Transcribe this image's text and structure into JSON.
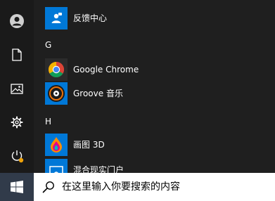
{
  "rail": {
    "items": [
      {
        "name": "user-account",
        "icon": "user-avatar-icon"
      },
      {
        "name": "documents",
        "icon": "document-icon"
      },
      {
        "name": "pictures",
        "icon": "picture-icon"
      },
      {
        "name": "settings",
        "icon": "gear-icon"
      },
      {
        "name": "power",
        "icon": "power-icon"
      }
    ],
    "power_badge_color": "#f0a30a"
  },
  "app_list": {
    "groups": [
      {
        "letter": "G"
      },
      {
        "letter": "H"
      }
    ],
    "apps": [
      {
        "label": "反馈中心",
        "icon": "feedback-hub-icon",
        "tile_color": "#0078d7"
      },
      {
        "label": "Google Chrome",
        "icon": "chrome-icon",
        "tile_color": "#2b2b2b"
      },
      {
        "label": "Groove 音乐",
        "icon": "groove-music-icon",
        "tile_color": "#0078d7"
      },
      {
        "label": "画图 3D",
        "icon": "paint-3d-icon",
        "tile_color": "#0078d7"
      },
      {
        "label": "混合现实门户",
        "icon": "mixed-reality-icon",
        "tile_color": "#0078d7"
      }
    ]
  },
  "taskbar": {
    "start_icon": "windows-logo-icon",
    "search": {
      "icon": "search-icon",
      "text": "在这里输入你要搜索的内容"
    }
  },
  "colors": {
    "accent": "#0078d7",
    "menu_bg": "#1f1f1f",
    "start_button_bg": "#313b4a"
  }
}
